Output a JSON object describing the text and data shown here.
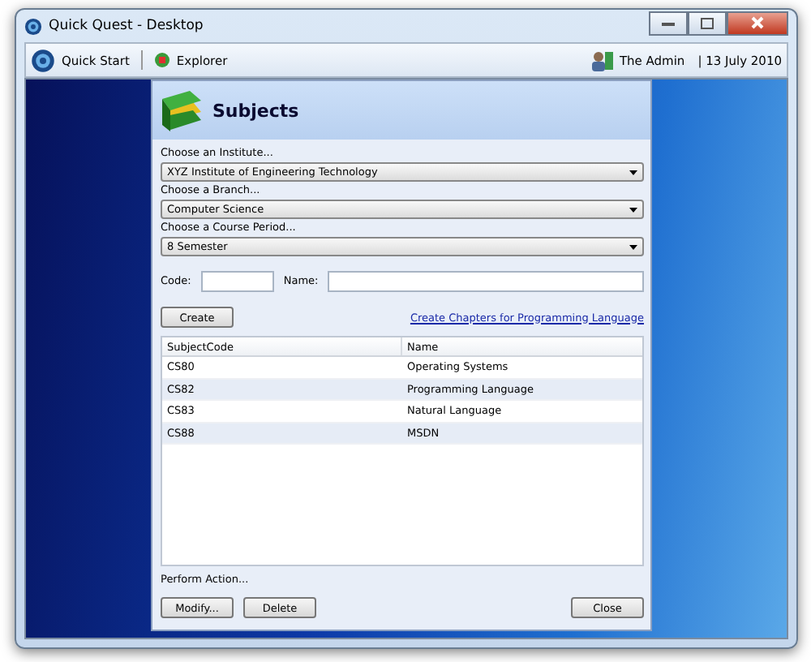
{
  "window": {
    "title": "Quick Quest - Desktop"
  },
  "toolbar": {
    "quick_start": "Quick Start",
    "explorer": "Explorer",
    "user": "The Admin",
    "date": "| 13 July 2010"
  },
  "dialog": {
    "title": "Subjects",
    "selects": [
      {
        "label": "Choose an Institute...",
        "value": "XYZ Institute of Engineering Technology"
      },
      {
        "label": "Choose a Branch...",
        "value": "Computer Science"
      },
      {
        "label": "Choose a Course Period...",
        "value": "8 Semester"
      }
    ],
    "code_label": "Code:",
    "name_label": "Name:",
    "create_button": "Create",
    "chapters_link": "Create Chapters for Programming Language",
    "table": {
      "columns": [
        "SubjectCode",
        "Name"
      ],
      "rows": [
        [
          "CS80",
          "Operating Systems"
        ],
        [
          "CS82",
          "Programming Language"
        ],
        [
          "CS83",
          "Natural Language"
        ],
        [
          "CS88",
          "MSDN"
        ]
      ]
    },
    "action_label": "Perform Action...",
    "buttons": [
      "Modify...",
      "Delete"
    ],
    "close_button": "Close"
  }
}
